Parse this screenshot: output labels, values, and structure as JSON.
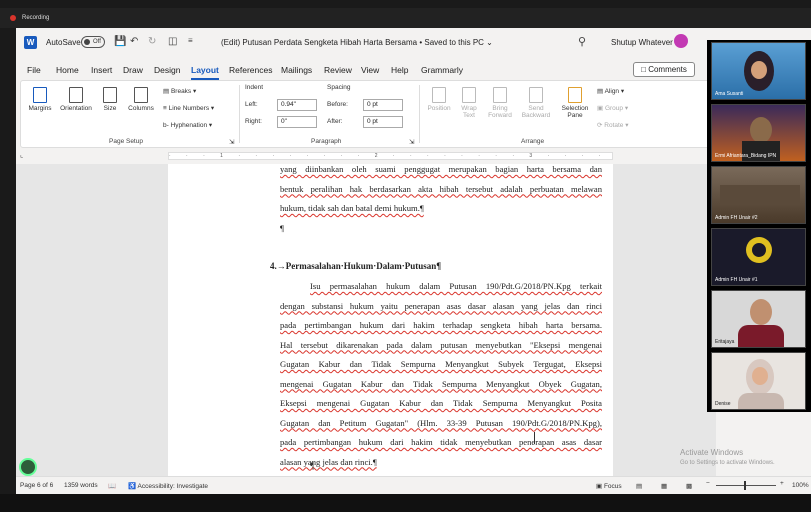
{
  "recording": {
    "label": "Recording"
  },
  "titlebar": {
    "autosave_label": "AutoSave",
    "autosave_state": "Off",
    "doc_title": "(Edit) Putusan Perdata Sengketa Hibah Harta Bersama • Saved to this PC ⌄",
    "user_name": "Shutup Whatever"
  },
  "menu": {
    "tabs": [
      "File",
      "Home",
      "Insert",
      "Draw",
      "Design",
      "Layout",
      "References",
      "Mailings",
      "Review",
      "View",
      "Help",
      "Grammarly"
    ],
    "active": "Layout",
    "comments_label": "Comments"
  },
  "ribbon": {
    "margins": "Margins",
    "orientation": "Orientation",
    "size": "Size",
    "columns": "Columns",
    "breaks": "Breaks ▾",
    "line_numbers": "Line Numbers ▾",
    "hyphenation": "Hyphenation ▾",
    "page_setup": "Page Setup",
    "indent_label": "Indent",
    "spacing_label": "Spacing",
    "left_label": "Left:",
    "left_value": "0.94\"",
    "right_label": "Right:",
    "right_value": "0\"",
    "before_label": "Before:",
    "before_value": "0 pt",
    "after_label": "After:",
    "after_value": "0 pt",
    "paragraph": "Paragraph",
    "position": "Position",
    "wrap_text": "Wrap Text",
    "bring_forward": "Bring Forward",
    "send_backward": "Send Backward",
    "selection_pane": "Selection Pane",
    "align": "Align ▾",
    "group": "Group ▾",
    "rotate": "Rotate ▾",
    "arrange": "Arrange"
  },
  "document": {
    "top_lines": [
      "yang diinbankan oleh suami penggugat merupakan bagian harta bersama dan",
      "bentuk peralihan hak berdasarkan akta hibah tersebut adalah perbuatan melawan",
      "hukum, tidak sah dan batal demi hukum.¶",
      "¶"
    ],
    "heading": "4.→Permasalahan·Hukum·Dalam·Putusan¶",
    "body_lines": [
      "Isu permasalahan hukum dalam Putusan 190/Pdt.G/2018/PN.Kpg terkait",
      "dengan substansi hukum yaitu penerapan asas dasar alasan yang jelas dan rinci",
      "pada pertimbangan hukum dari hakim terhadap sengketa hibah harta bersama.",
      "Hal tersebut dikarenakan pada dalam putusan menyebutkan \"Eksepsi mengenai",
      "Gugatan Kabur dan Tidak Sempurna Menyangkut Subyek Tergugat, Eksepsi",
      "mengenai Gugatan Kabur dan Tidak Sempurna Menyangkut Obyek Gugatan,",
      "Eksepsi mengenai Gugatan Kabur dan Tidak Sempurna Menyangkut Posita",
      "Gugatan dan Petitum Gugatan\" (Hlm. 33-39 Putusan 190/Pdt.G/2018/PN.Kpg),",
      "pada pertimbangan hukum dari hakim tidak menyebutkan penerapan asas dasar",
      "alasan yang jelas dan rinci.¶"
    ],
    "end_mark": "¶"
  },
  "statusbar": {
    "page": "Page 6 of 6",
    "words": "1359 words",
    "accessibility": "Accessibility: Investigate",
    "focus": "Focus",
    "zoom": "100%"
  },
  "watermark": {
    "line1": "Activate Windows",
    "line2": "Go to Settings to activate Windows."
  },
  "participants": [
    {
      "name": "Ama Susanti"
    },
    {
      "name": "Ermi Afriantara_Bidang IPN"
    },
    {
      "name": "Admin FH Unair #2"
    },
    {
      "name": "Admin FH Unair #1"
    },
    {
      "name": "Eritajaya"
    },
    {
      "name": "Denise"
    }
  ],
  "colors": {
    "word_blue": "#185abd",
    "avatar_magenta": "#c239b3",
    "spell_red": "#d9342b"
  }
}
